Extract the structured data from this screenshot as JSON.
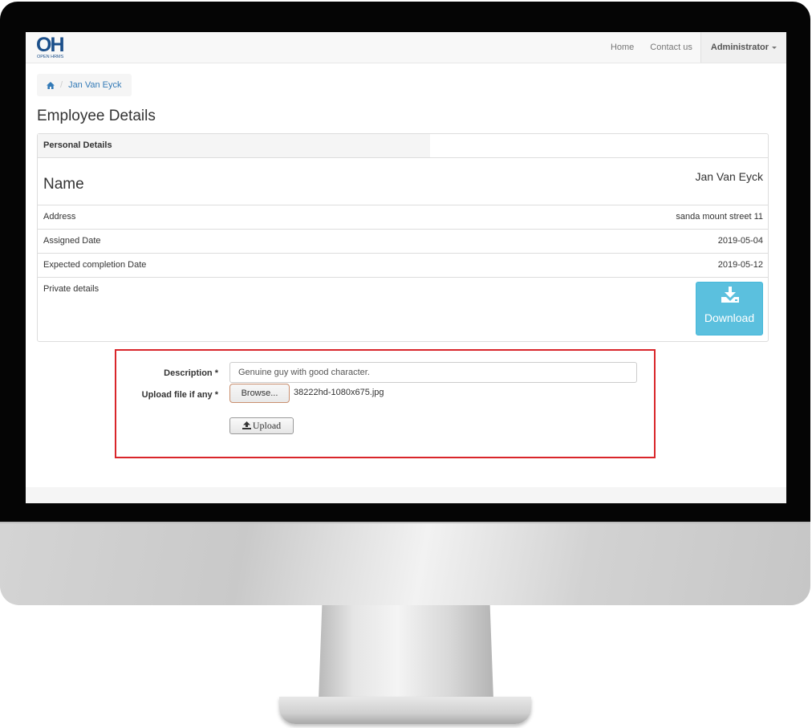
{
  "navbar": {
    "logo": {
      "mark": "OH",
      "text": "OPEN HRMS",
      "color": "#1b4f8a"
    },
    "links": [
      {
        "label": "Home"
      },
      {
        "label": "Contact us"
      }
    ],
    "user_menu": {
      "label": "Administrator",
      "icon": "caret-down-icon"
    }
  },
  "breadcrumb": {
    "home_icon": "home-icon",
    "items": [
      {
        "label": "Jan Van Eyck"
      }
    ]
  },
  "page_title": "Employee Details",
  "panel": {
    "heading": "Personal Details",
    "name": {
      "label": "Name",
      "value": "Jan Van Eyck"
    },
    "rows": [
      {
        "label": "Address",
        "value": "sanda mount street 11"
      },
      {
        "label": "Assigned Date",
        "value": "2019-05-04"
      },
      {
        "label": "Expected completion Date",
        "value": "2019-05-12"
      }
    ],
    "private": {
      "label": "Private details",
      "download_label": "Download",
      "download_icon": "download-icon",
      "button_color": "#5bc0de"
    }
  },
  "upload_form": {
    "highlight_color": "#d9262b",
    "description_label": "Description *",
    "description_value": "Genuine guy with good character.",
    "file_label": "Upload file if any *",
    "browse_label": "Browse...",
    "file_name": "38222hd-1080x675.jpg",
    "upload_label": "Upload",
    "upload_icon": "upload-icon"
  }
}
